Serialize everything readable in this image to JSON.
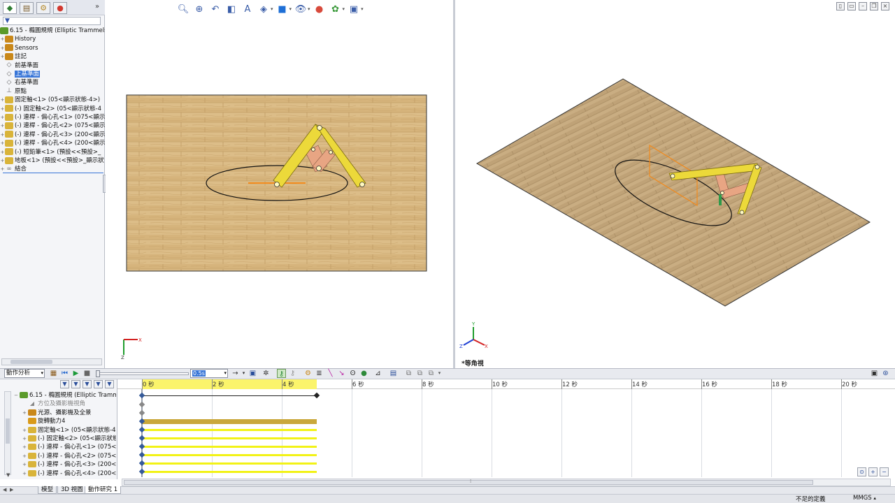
{
  "feature_tree": {
    "filter_icon": "funnel-icon",
    "root": "6.15 - 橢圓規規 (Elliptic Trammels",
    "items": [
      {
        "label": "History",
        "icon": "history-icon",
        "selected": false
      },
      {
        "label": "Sensors",
        "icon": "sensor-icon",
        "selected": false
      },
      {
        "label": "註記",
        "icon": "annotation-icon",
        "selected": false
      },
      {
        "label": "前基準面",
        "icon": "plane-icon",
        "selected": false
      },
      {
        "label": "上基準面",
        "icon": "plane-icon",
        "selected": true
      },
      {
        "label": "右基準面",
        "icon": "plane-icon",
        "selected": false
      },
      {
        "label": "原點",
        "icon": "origin-icon",
        "selected": false
      },
      {
        "label": "固定軸<1> (05<顯示狀態-4>)",
        "icon": "part-icon",
        "selected": false
      },
      {
        "label": "(-) 固定軸<2> (05<顯示狀態-4",
        "icon": "part-icon",
        "selected": false
      },
      {
        "label": "(-) 連桿 - 偏心孔<1> (075<顯示",
        "icon": "part-icon",
        "selected": false
      },
      {
        "label": "(-) 連桿 - 偏心孔<2> (075<顯示",
        "icon": "part-icon",
        "selected": false
      },
      {
        "label": "(-) 連桿 - 偏心孔<3> (200<顯示",
        "icon": "part-icon",
        "selected": false
      },
      {
        "label": "(-) 連桿 - 偏心孔<4> (200<顯示",
        "icon": "part-icon",
        "selected": false
      },
      {
        "label": "(-) 短鉛筆<1> (預設<<預設>_",
        "icon": "part-icon",
        "selected": false
      },
      {
        "label": "地板<1> (預設<<預設>_顯示狀",
        "icon": "part-icon",
        "selected": false
      },
      {
        "label": "結合",
        "icon": "mates-icon",
        "selected": false
      }
    ]
  },
  "viewport_right": {
    "view_label": "*等角視"
  },
  "motion_study": {
    "type": "動作分析",
    "speed": "0.5s",
    "tree_root": "6.15 - 橢圓規規 (Elliptic Tramm",
    "tree_items": [
      {
        "label": "方位及攝影機視角",
        "icon": "camera-icon"
      },
      {
        "label": "光源、攝影機及全景",
        "icon": "lights-icon"
      },
      {
        "label": "旋轉動力4",
        "icon": "motor-icon"
      },
      {
        "label": "固定軸<1> (05<顯示狀態-4",
        "icon": "part-icon"
      },
      {
        "label": "(-) 固定軸<2> (05<顯示狀態",
        "icon": "part-icon"
      },
      {
        "label": "(-) 連桿 - 偏心孔<1> (075<顯",
        "icon": "part-icon"
      },
      {
        "label": "(-) 連桿 - 偏心孔<2> (075<顯",
        "icon": "part-icon"
      },
      {
        "label": "(-) 連桿 - 偏心孔<3> (200<顯",
        "icon": "part-icon"
      },
      {
        "label": "(-) 連桿 - 偏心孔<4> (200<顯",
        "icon": "part-icon"
      }
    ],
    "time_ticks": [
      "0 秒",
      "2 秒",
      "4 秒",
      "6 秒",
      "8 秒",
      "10 秒",
      "12 秒",
      "14 秒",
      "16 秒",
      "18 秒",
      "20 秒"
    ]
  },
  "bottom_tabs": [
    "模型",
    "3D 視圖",
    "動作研究 1"
  ],
  "status": {
    "message": "不足的定義",
    "units": "MMGS"
  },
  "colors": {
    "wood": "#d9b883",
    "link_yellow": "#ecd93a",
    "link_salmon": "#e8a583",
    "pencil_orange": "#f28a1c",
    "selection_blue": "#3875d7",
    "timeline_yellow": "#f2f216"
  }
}
